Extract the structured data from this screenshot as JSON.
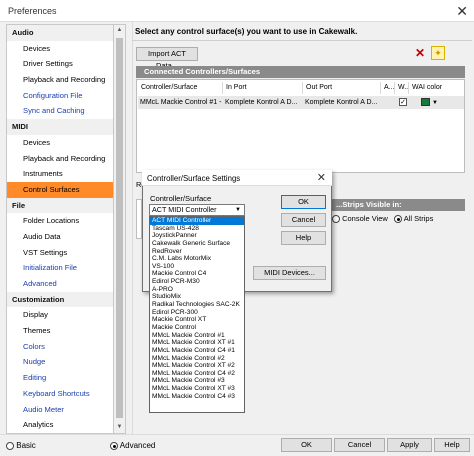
{
  "window": {
    "title": "Preferences",
    "close_glyph": "✕"
  },
  "nav": {
    "items": [
      {
        "label": "Audio",
        "kind": "cat"
      },
      {
        "label": "Devices",
        "kind": "sub"
      },
      {
        "label": "Driver Settings",
        "kind": "sub"
      },
      {
        "label": "Playback and Recording",
        "kind": "sub"
      },
      {
        "label": "Configuration File",
        "kind": "link"
      },
      {
        "label": "Sync and Caching",
        "kind": "link"
      },
      {
        "label": "MIDI",
        "kind": "cat"
      },
      {
        "label": "Devices",
        "kind": "sub"
      },
      {
        "label": "Playback and Recording",
        "kind": "sub"
      },
      {
        "label": "Instruments",
        "kind": "sub"
      },
      {
        "label": "Control Surfaces",
        "kind": "selected"
      },
      {
        "label": "File",
        "kind": "cat"
      },
      {
        "label": "Folder Locations",
        "kind": "sub"
      },
      {
        "label": "Audio Data",
        "kind": "sub"
      },
      {
        "label": "VST Settings",
        "kind": "sub"
      },
      {
        "label": "Initialization File",
        "kind": "link"
      },
      {
        "label": "Advanced",
        "kind": "link"
      },
      {
        "label": "Customization",
        "kind": "cat"
      },
      {
        "label": "Display",
        "kind": "sub"
      },
      {
        "label": "Themes",
        "kind": "sub"
      },
      {
        "label": "Colors",
        "kind": "link"
      },
      {
        "label": "Nudge",
        "kind": "link"
      },
      {
        "label": "Editing",
        "kind": "link"
      },
      {
        "label": "Keyboard Shortcuts",
        "kind": "link"
      },
      {
        "label": "Audio Meter",
        "kind": "link"
      },
      {
        "label": "Analytics",
        "kind": "sub"
      }
    ]
  },
  "main": {
    "prompt": "Select any control surface(s) you want to use in Cakewalk.",
    "import_button": "Import ACT Data...",
    "connected_header": "Connected Controllers/Surfaces",
    "columns": [
      "Controller/Surface",
      "In Port",
      "Out Port",
      "A...",
      "W...",
      "WAI color"
    ],
    "row": {
      "controller": "MMcL Mackie Control #1 - ...",
      "in_port": "Komplete Kontrol A D...",
      "out_port": "Komplete Kontrol A D...",
      "wai_checked": true
    },
    "partial_label": "Re",
    "strips_header": "...Strips Visible in:",
    "strips_options": [
      "Console View",
      "All Strips"
    ],
    "strips_selected": "All Strips"
  },
  "bottom": {
    "basic_label": "Basic",
    "advanced_label": "Advanced",
    "selected_mode": "Advanced",
    "ok": "OK",
    "cancel": "Cancel",
    "apply": "Apply",
    "help": "Help"
  },
  "modal": {
    "title": "Controller/Surface Settings",
    "field_label": "Controller/Surface",
    "selected_value": "ACT MIDI Controller",
    "ok": "OK",
    "cancel": "Cancel",
    "help": "Help",
    "midi_devices": "MIDI Devices...",
    "options": [
      "ACT MIDI Controller",
      "Tascam US-428",
      "JoystickPanner",
      "Cakewalk Generic Surface",
      "RedRover",
      "C.M. Labs MotorMix",
      "VS-100",
      "Mackie Control C4",
      "Edirol PCR-M30",
      "A-PRO",
      "StudioMix",
      "Radikal Technologies SAC-2K",
      "Edirol PCR-300",
      "Mackie Control XT",
      "Mackie Control",
      "MMcL Mackie Control #1",
      "MMcL Mackie Control XT #1",
      "MMcL Mackie Control C4 #1",
      "MMcL Mackie Control #2",
      "MMcL Mackie Control XT #2",
      "MMcL Mackie Control C4 #2",
      "MMcL Mackie Control #3",
      "MMcL Mackie Control XT #3",
      "MMcL Mackie Control C4 #3"
    ]
  },
  "colors": {
    "selection": "#ff8a2a",
    "dropdown_highlight": "#0078d7",
    "header_gray": "#8a8a8a",
    "wai_swatch": "#157a3c"
  }
}
